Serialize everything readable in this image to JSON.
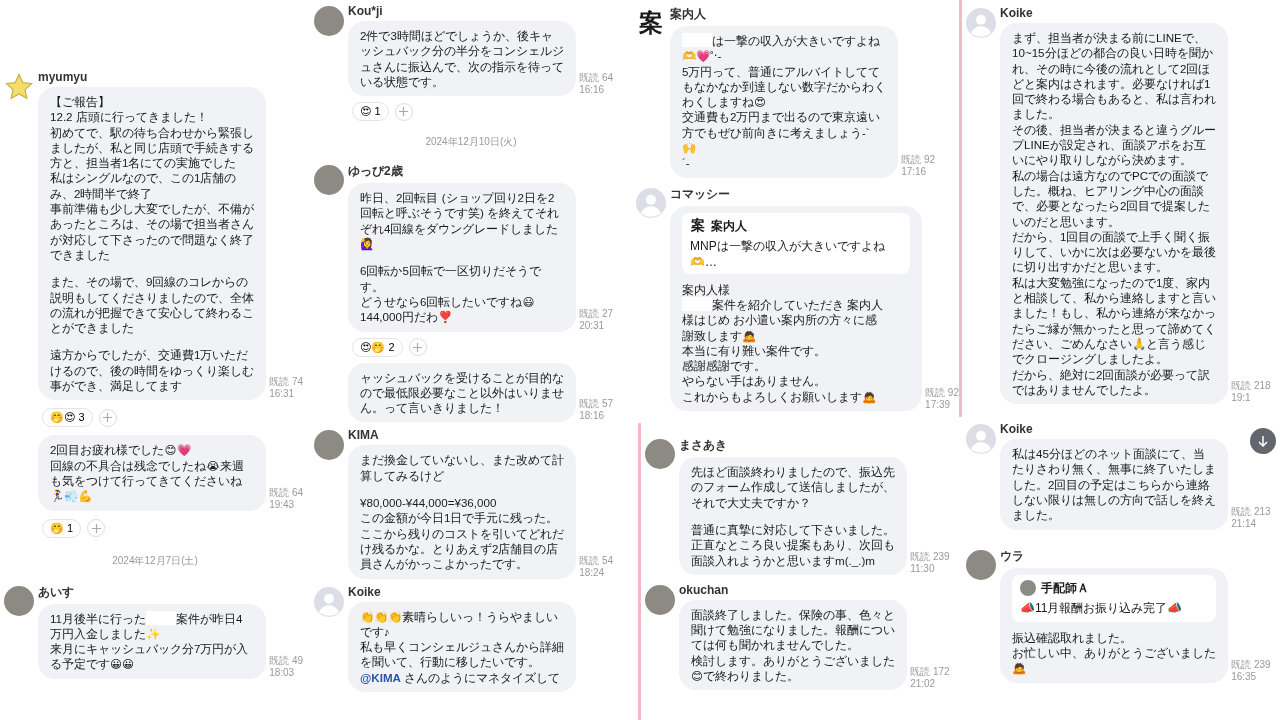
{
  "columns": [
    {
      "panels": [
        {
          "items": [
            {
              "kind": "message",
              "name": "myumyu",
              "avatar": {
                "kind": "star"
              },
              "paragraphs": [
                [
                  "【ご報告】",
                  "12.2 店頭に行ってきました！",
                  "初めてで、駅の待ち合わせから緊張しましたが、私と同じ店頭で手続きする方と、担当者1名にての実施でした",
                  "私はシングルなので、この1店舗のみ、2時間半で終了",
                  "事前準備も少し大変でしたが、不備があったところは、その場で担当者さんが対応して下さったので問題なく終了できました"
                ],
                [
                  "また、その場で、9回線のコレからの説明もしてくださりましたので、全体の流れが把握できて安心して終わることができました"
                ],
                [
                  "遠方からでしたが、交通費1万いただけるので、後の時間をゆっくり楽しむ事ができ、満足してます"
                ]
              ],
              "receipt": "既読 74",
              "time": "16:31"
            },
            {
              "kind": "reactions",
              "emojis": "🤭😍",
              "count": "3"
            },
            {
              "kind": "message",
              "paragraphs": [
                [
                  "2回目お疲れ様でした😊💗",
                  "回線の不具合は残念でしたね😭来週も気をつけて行ってきてくださいね🏃‍♀️💨💪"
                ]
              ],
              "receipt": "既読 64",
              "time": "19:43"
            },
            {
              "kind": "reactions",
              "emojis": "🤭",
              "count": "1"
            },
            {
              "kind": "date",
              "text": "2024年12月7日(土)"
            },
            {
              "kind": "message",
              "name": "あいす",
              "avatar": {
                "kind": "photo"
              },
              "paragraphs": [
                [
                  {
                    "parts": [
                      {
                        "kind": "text",
                        "text": "11月後半に行った"
                      },
                      {
                        "kind": "redacted"
                      },
                      {
                        "kind": "text",
                        "text": "案件が昨日4万円入金しました✨"
                      }
                    ]
                  },
                  "来月にキャッシュバック分7万円が入る予定です😀😀"
                ]
              ],
              "receipt": "既読 49",
              "time": "18:03"
            }
          ]
        }
      ]
    },
    {
      "panels": [
        {
          "items": [
            {
              "kind": "message",
              "name": "Kou*ji",
              "avatar": {
                "kind": "photo"
              },
              "paragraphs": [
                [
                  "2件で3時間ほどでしょうか、後キャッシュバック分の半分をコンシェルジュさんに振込んで、次の指示を待っている状態です。"
                ]
              ],
              "receipt": "既読 64",
              "time": "16:16"
            },
            {
              "kind": "reactions",
              "emojis": "😍",
              "count": "1"
            },
            {
              "kind": "date",
              "text": "2024年12月10日(火)"
            },
            {
              "kind": "message",
              "name": "ゆっぴ2歳",
              "avatar": {
                "kind": "photo"
              },
              "paragraphs": [
                [
                  "昨日、2回転目 (ショップ回り2日を2回転と呼ぶそうです笑) を終えてそれぞれ4回線をダウングレードしました🙋‍♀️"
                ],
                [
                  "6回転か5回転で一区切りだそうです。",
                  "どうせなら6回転したいですね😃",
                  "144,000円だわ❣️"
                ]
              ],
              "receipt": "既読 27",
              "time": "20:31"
            },
            {
              "kind": "reactions",
              "emojis": "😍🤭",
              "count": "2"
            },
            {
              "kind": "message",
              "paragraphs": [
                [
                  "ャッシュバックを受けることが目的なので最低限必要なこと以外はいりません。って言いきりました！"
                ]
              ],
              "receipt": "既読 57",
              "time": "18:16"
            },
            {
              "kind": "message",
              "name": "KIMA",
              "avatar": {
                "kind": "photo"
              },
              "paragraphs": [
                [
                  "まだ換金していないし、また改めて計算してみるけど"
                ],
                [
                  "¥80,000-¥44,000=¥36,000",
                  "この金額が今日1日で手元に残った。",
                  "ここから残りのコストを引いてどれだけ残るかな。とりあえず2店舗目の店員さんがかっこよかったです。"
                ]
              ],
              "receipt": "既読 54",
              "time": "18:24"
            },
            {
              "kind": "message",
              "name": "Koike",
              "avatar": {
                "kind": "default"
              },
              "paragraphs": [
                [
                  "👏👏👏素晴らしいっ！うらやましいです♪",
                  "私も早くコンシェルジュさんから詳細を聞いて、行動に移したいです。",
                  {
                    "parts": [
                      {
                        "kind": "mention",
                        "text": "@KIMA"
                      },
                      {
                        "kind": "text",
                        "text": " さんのようにマネタイズして"
                      }
                    ]
                  }
                ]
              ]
            }
          ]
        }
      ]
    },
    {
      "panels": [
        {
          "items": [
            {
              "kind": "message",
              "name": "案内人",
              "avatar": {
                "kind": "glyph",
                "text": "案"
              },
              "paragraphs": [
                [
                  {
                    "parts": [
                      {
                        "kind": "redacted"
                      },
                      {
                        "kind": "text",
                        "text": "は一撃の収入が大きいですよね"
                      }
                    ]
                  },
                  "🫶💗˚‧-",
                  "5万円って、普通にアルバイトしててもなかなか到達しない数字だからわくわくしますね😍",
                  "交通費も2万円まで出るので東京遠い方でもぜひ前向きに考えましょう-` 🙌",
                  "´-"
                ]
              ],
              "receipt": "既読 92",
              "time": "17:16"
            },
            {
              "kind": "message",
              "name": "コマッシー",
              "avatar": {
                "kind": "default"
              },
              "quote": {
                "avatar": {
                  "kind": "glyph",
                  "text": "案"
                },
                "name": "案内人",
                "text": "MNPは一撃の収入が大きいですよね🫶…"
              },
              "paragraphs": [
                [
                  "案内人様",
                  {
                    "parts": [
                      {
                        "kind": "redacted"
                      },
                      {
                        "kind": "text",
                        "text": "案件を紹介していただき 案内人様はじめ お小遣い案内所の方々に感謝致します🙇"
                      }
                    ]
                  },
                  "本当に有り難い案件です。",
                  "感謝感謝です。",
                  "やらない手はありません。",
                  "これからもよろしくお願いします🙇"
                ]
              ],
              "receipt": "既読 92",
              "time": "17:39"
            }
          ]
        },
        {
          "items": [
            {
              "kind": "message",
              "name": "まさあき",
              "avatar": {
                "kind": "photo"
              },
              "paragraphs": [
                [
                  "先ほど面談終わりましたので、振込先のフォーム作成して送信しましたが、それで大丈夫ですか？"
                ],
                [
                  "普通に真摯に対応して下さいました。",
                  "正直なところ良い提案もあり、次回も面談入れようかと思いますm(._.)m"
                ]
              ],
              "receipt": "既読 239",
              "time": "11:30"
            },
            {
              "kind": "message",
              "name": "okuchan",
              "avatar": {
                "kind": "photo"
              },
              "paragraphs": [
                [
                  "面談終了しました。保険の事、色々と聞けて勉強になりました。報酬については何も聞かれませんでした。",
                  "検討します。ありがとうございました😊で終わりました。"
                ]
              ],
              "receipt": "既読 172",
              "time": "21:02"
            }
          ]
        }
      ]
    },
    {
      "panels": [
        {
          "items": [
            {
              "kind": "message",
              "name": "Koike",
              "avatar": {
                "kind": "default"
              },
              "paragraphs": [
                [
                  "まず、担当者が決まる前にLINEで、10~15分ほどの都合の良い日時を聞かれ、その時に今後の流れとして2回ほどと案内はされます。必要なければ1回で終わる場合もあると、私は言われました。",
                  "その後、担当者が決まると違うグループLINEが設定され、面談アポをお互いにやり取りしながら決めます。",
                  "私の場合は遠方なのでPCでの面談でした。概ね、ヒアリング中心の面談で、必要となったら2回目で提案したいのだと思います。",
                  "だから、1回目の面談で上手く聞く振りして、いかに次は必要ないかを最後に切り出すかだと思います。",
                  "私は大変勉強になったので1度、家内と相談して、私から連絡しますと言いました！もし、私から連絡が来なかったらご縁が無かったと思って諦めてください、ごめんなさい🙏と言う感じでクロージングしましたよ。",
                  "だから、絶対に2回面談が必要って訳ではありませんでしたよ。"
                ]
              ],
              "receipt": "既読 218",
              "time": "19:1"
            },
            {
              "kind": "message",
              "name": "Koike",
              "avatar": {
                "kind": "default"
              },
              "paragraphs": [
                [
                  "私は45分ほどのネット面談にて、当たりさわり無く、無事に終了いたしました。2回目の予定はこちらから連絡しない限りは無しの方向で話しを終えました。"
                ]
              ],
              "receipt": "既読 213",
              "time": "21:14"
            },
            {
              "kind": "message",
              "name": "ウラ",
              "avatar": {
                "kind": "photo"
              },
              "quote": {
                "avatar": {
                  "kind": "photo"
                },
                "name": "手配師Ａ",
                "text": "📣11月報酬お振り込み完了📣"
              },
              "paragraphs": [
                [
                  "振込確認取れました。",
                  "お忙しい中、ありがとうございました🙇"
                ]
              ],
              "receipt": "既読 239",
              "time": "16:35"
            }
          ]
        }
      ]
    }
  ]
}
